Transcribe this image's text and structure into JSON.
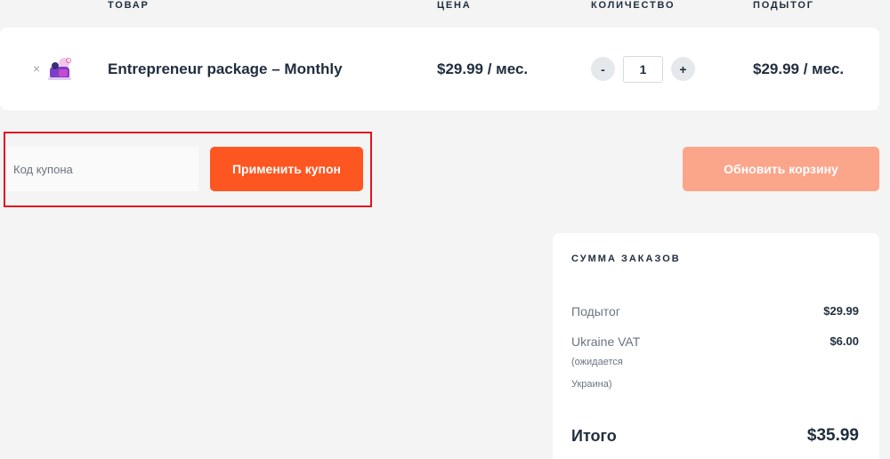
{
  "table_header": {
    "product": "ТОВАР",
    "price": "ЦЕНА",
    "quantity": "КОЛИЧЕСТВО",
    "subtotal": "ПОДЫТОГ"
  },
  "cart_item": {
    "remove_icon": "×",
    "name": "Entrepreneur package – Monthly",
    "price": "$29.99 / мес.",
    "qty_minus": "-",
    "qty_value": "1",
    "qty_plus": "+",
    "subtotal": "$29.99 / мес."
  },
  "coupon": {
    "placeholder": "Код купона",
    "apply_label": "Применить купон"
  },
  "update_cart_label": "Обновить корзину",
  "totals": {
    "title": "СУММА ЗАКАЗОВ",
    "subtotal_label": "Подытог",
    "subtotal_value": "$29.99",
    "vat_label": "Ukraine VAT",
    "vat_value": "$6.00",
    "vat_note_line1": "(ожидается",
    "vat_note_line2": "Украина)",
    "total_label": "Итого",
    "total_value": "$35.99"
  },
  "colors": {
    "accent": "#fe5621",
    "accent_disabled": "#fba58b",
    "highlight": "#e0141e"
  }
}
